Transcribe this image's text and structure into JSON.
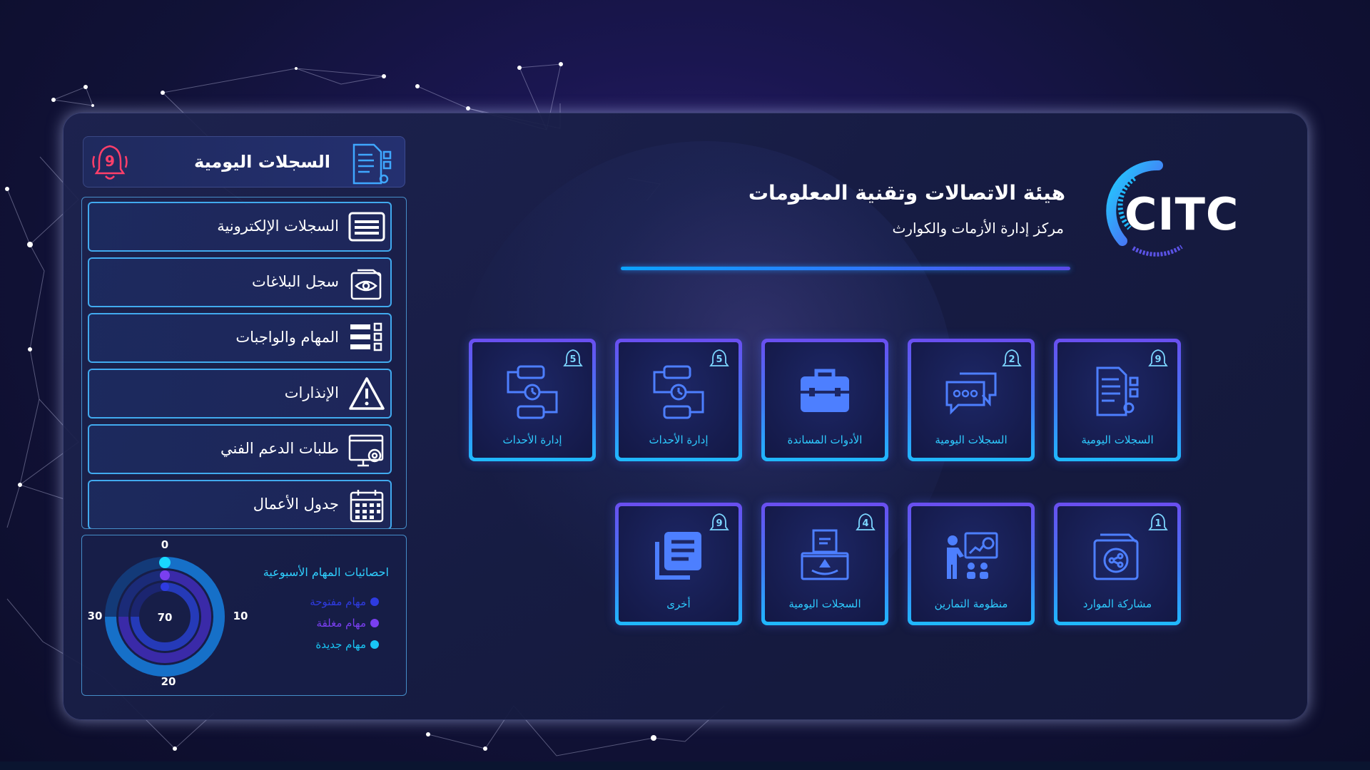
{
  "brand": {
    "title": "هيئة الاتصالات وتقنية المعلومات",
    "subtitle": "مركز إدارة الأزمات والكوارث",
    "logo_text": "CITC"
  },
  "sidebar": {
    "header": {
      "title": "السجلات اليومية",
      "badge": "9",
      "icon": "document-settings-icon"
    },
    "items": [
      {
        "label": "السجلات الإلكترونية",
        "icon": "monitor-list-icon"
      },
      {
        "label": "سجل البلاغات",
        "icon": "folder-eye-icon"
      },
      {
        "label": "المهام والواجبات",
        "icon": "checklist-icon"
      },
      {
        "label": "الإنذارات",
        "icon": "warning-icon"
      },
      {
        "label": "طلبات الدعم الفني",
        "icon": "screen-gear-icon"
      },
      {
        "label": "جدول الأعمال",
        "icon": "calendar-icon"
      }
    ]
  },
  "stats": {
    "title": "احصائيات المهام الأسبوعية",
    "legend": [
      {
        "label": "مهام مفتوحة",
        "color": "#2e3be0"
      },
      {
        "label": "مهام مغلقة",
        "color": "#7a3ff0"
      },
      {
        "label": "مهام جديدة",
        "color": "#19c6f5"
      }
    ],
    "ticks": {
      "top": "0",
      "right": "10",
      "bottom": "20",
      "left": "30"
    },
    "center_value": "70"
  },
  "tiles": {
    "row1": [
      {
        "label": "السجلات اليومية",
        "badge": "9",
        "icon": "document-settings-icon"
      },
      {
        "label": "السجلات اليومية",
        "badge": "2",
        "icon": "chat-bubbles-icon"
      },
      {
        "label": "الأدوات المساندة",
        "badge": "",
        "icon": "toolbox-icon"
      },
      {
        "label": "إدارة الأحداث",
        "badge": "5",
        "icon": "event-flow-icon"
      },
      {
        "label": "إدارة الأحداث",
        "badge": "5",
        "icon": "event-flow-icon"
      }
    ],
    "row2": [
      {
        "label": "مشاركة الموارد",
        "badge": "1",
        "icon": "share-folder-icon"
      },
      {
        "label": "منظومة التمارين",
        "badge": "",
        "icon": "presentation-icon"
      },
      {
        "label": "السجلات اليومية",
        "badge": "4",
        "icon": "ballot-box-icon"
      },
      {
        "label": "أخرى",
        "badge": "9",
        "icon": "documents-stack-icon"
      }
    ]
  },
  "colors": {
    "accent_cyan": "#2ecbff",
    "accent_purple": "#6a4ef0",
    "panel_bg": "#1b214f"
  }
}
